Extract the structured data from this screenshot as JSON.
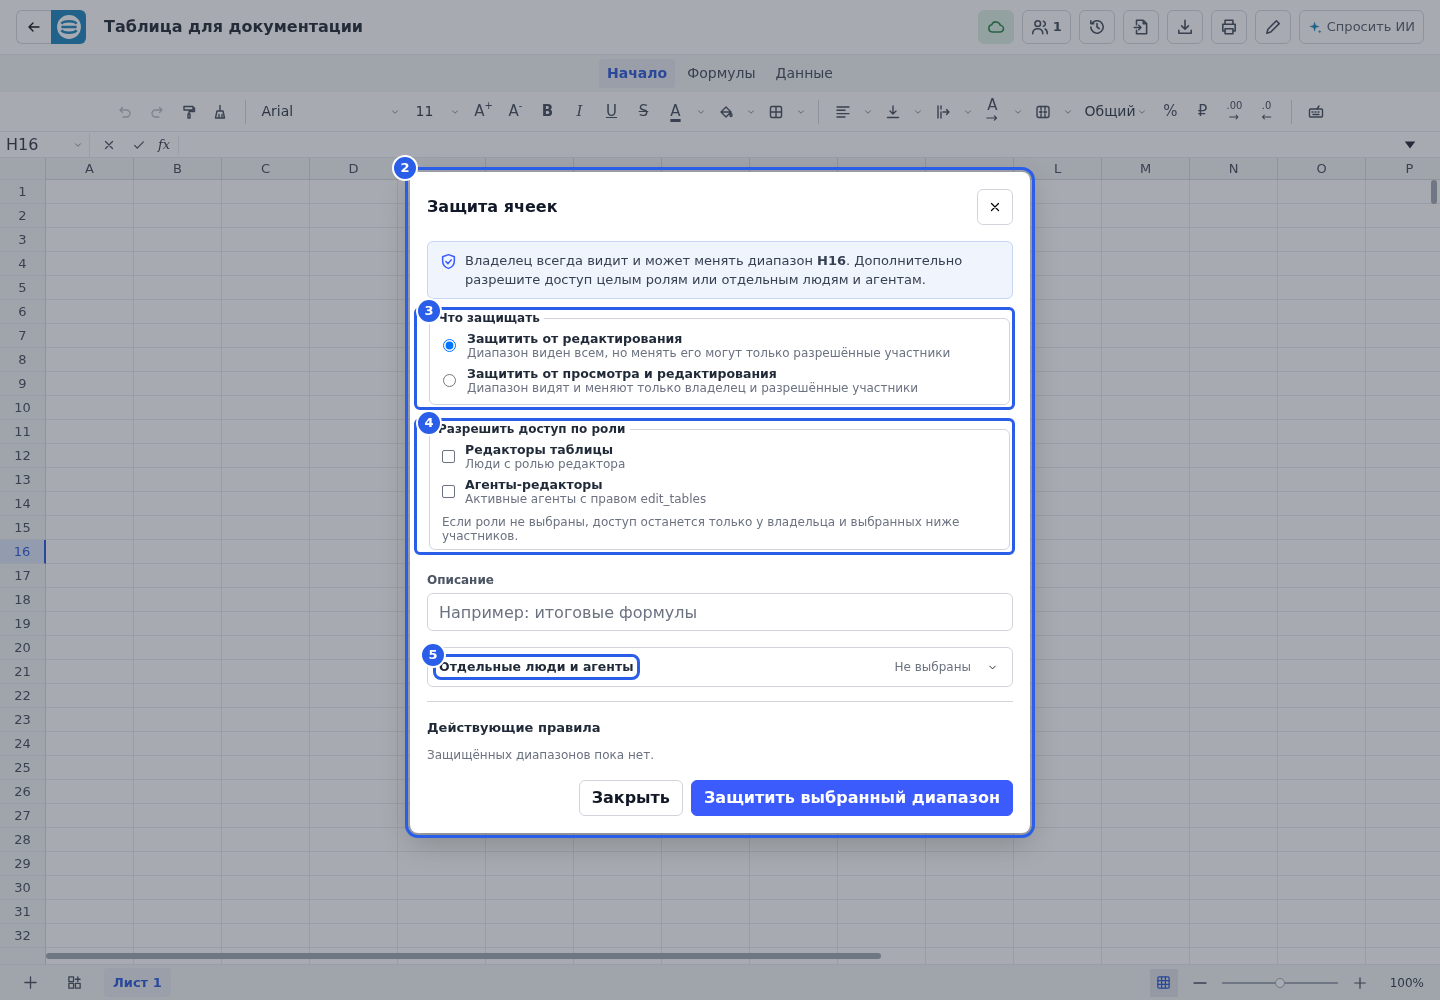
{
  "header": {
    "title": "Таблица для документации",
    "collaborators_count": "1",
    "ask_ai": "Спросить ИИ"
  },
  "menu_tabs": [
    {
      "label": "Начало",
      "selected": true
    },
    {
      "label": "Формулы",
      "selected": false
    },
    {
      "label": "Данные",
      "selected": false
    }
  ],
  "toolbar": {
    "undo_disabled": true,
    "redo_disabled": true,
    "font": "Arial",
    "font_size": "11",
    "grow_font": "A$^{+}$",
    "shrink_font": "A$^{-}$",
    "bold": "B",
    "italic": "I",
    "underline": "U",
    "strike": "S",
    "text_color": "A",
    "wrap_color": "A",
    "number_format": "Общий",
    "percent": "%",
    "currency": "₽",
    "increase_decimal": ".00",
    "decrease_decimal": ".0"
  },
  "formula_bar": {
    "cell_ref": "H16",
    "fx": "fx"
  },
  "grid": {
    "columns_left": [
      "A",
      "B",
      "C",
      "D"
    ],
    "columns_right": [
      "L",
      "M",
      "N",
      "O",
      "P"
    ],
    "rows": [
      {
        "label": "1",
        "selected": false
      },
      {
        "label": "2",
        "selected": false
      },
      {
        "label": "3",
        "selected": false
      },
      {
        "label": "4",
        "selected": false
      },
      {
        "label": "5",
        "selected": false
      },
      {
        "label": "6",
        "selected": false
      },
      {
        "label": "7",
        "selected": false
      },
      {
        "label": "8",
        "selected": false
      },
      {
        "label": "9",
        "selected": false
      },
      {
        "label": "10",
        "selected": false
      },
      {
        "label": "11",
        "selected": false
      },
      {
        "label": "12",
        "selected": false
      },
      {
        "label": "13",
        "selected": false
      },
      {
        "label": "14",
        "selected": false
      },
      {
        "label": "15",
        "selected": false
      },
      {
        "label": "16",
        "selected": true
      },
      {
        "label": "17",
        "selected": false
      },
      {
        "label": "18",
        "selected": false
      },
      {
        "label": "19",
        "selected": false
      },
      {
        "label": "20",
        "selected": false
      },
      {
        "label": "21",
        "selected": false
      },
      {
        "label": "22",
        "selected": false
      },
      {
        "label": "23",
        "selected": false
      },
      {
        "label": "24",
        "selected": false
      },
      {
        "label": "25",
        "selected": false
      },
      {
        "label": "26",
        "selected": false
      },
      {
        "label": "27",
        "selected": false
      },
      {
        "label": "28",
        "selected": false
      },
      {
        "label": "29",
        "selected": false
      },
      {
        "label": "30",
        "selected": false
      },
      {
        "label": "31",
        "selected": false
      },
      {
        "label": "32",
        "selected": false
      }
    ]
  },
  "sheets": [
    {
      "label": "Лист 1",
      "selected": true
    }
  ],
  "zoom": {
    "level": 0.5,
    "reading": "100%"
  },
  "dialog": {
    "title": "Защита ячеек",
    "info": "Владелец всегда видит и может менять диапазон **H16**. Дополнительно разрешите доступ целым ролям или отдельным людям и агентам.",
    "protect_section": {
      "legend": "Что защищать",
      "options": [
        {
          "title": "Защитить от редактирования",
          "description": "Диапазон виден всем, но менять его могут только разрешённые участники",
          "selected": true
        },
        {
          "title": "Защитить от просмотра и редактирования",
          "description": "Диапазон видят и меняют только владелец и разрешённые участники",
          "selected": false
        }
      ]
    },
    "roles_section": {
      "legend": "Разрешить доступ по роли",
      "options": [
        {
          "title": "Редакторы таблицы",
          "description": "Люди с ролью редактора",
          "checked": false
        },
        {
          "title": "Агенты-редакторы",
          "description": "Активные агенты с правом edit_tables",
          "checked": false
        }
      ],
      "note": "Если роли не выбраны, доступ останется только у владельца и выбранных ниже участников."
    },
    "description_field": {
      "label": "Описание",
      "placeholder": "Например: итоговые формулы"
    },
    "people_select": {
      "label": "Отдельные люди и агенты",
      "value": "Не выбраны"
    },
    "rules": {
      "heading": "Действующие правила",
      "empty_text": "Защищённых диапазонов пока нет."
    },
    "buttons": [
      {
        "label": "Закрыть",
        "kind": "secondary"
      },
      {
        "label": "Защитить выбранный диапазон",
        "kind": "primary"
      }
    ]
  },
  "annotations": [
    "2",
    "3",
    "4",
    "5"
  ]
}
